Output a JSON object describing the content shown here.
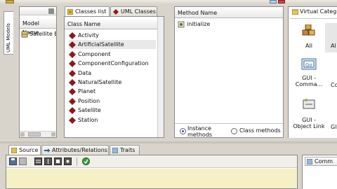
{
  "side_tab": {
    "label": "UML Models"
  },
  "models_panel": {
    "column_header": "Model Name",
    "items": [
      "Satellite E"
    ]
  },
  "classes_tabs": [
    {
      "label": "Classes list",
      "active": true
    },
    {
      "label": "UML Classes",
      "active": false
    }
  ],
  "classes_list": {
    "header": "Class Name",
    "items": [
      "Activity",
      "ArtificialSatellite",
      "Component",
      "ComponentConfiguration",
      "Data",
      "NaturalSatellite",
      "Planet",
      "Position",
      "Satellite",
      "Station"
    ],
    "selected_index": 1
  },
  "methods_panel": {
    "header": "Method Name",
    "items": [
      "initialize"
    ],
    "radio_instance": "Instance methods",
    "radio_class": "Class methods",
    "selected_radio": "instance"
  },
  "virtual_panel": {
    "tab_label": "Virtual Categ",
    "tiles": [
      "All",
      "GUI - Comma...",
      "GUI - Object Link"
    ],
    "partial_tiles": [
      "Al",
      "Co",
      "Gl"
    ]
  },
  "bottom_tabs": [
    {
      "label": "Source",
      "active": true
    },
    {
      "label": "Attributes/Relations",
      "active": false
    },
    {
      "label": "Traits",
      "active": false
    }
  ],
  "comm_panel": {
    "label": "Comm"
  },
  "colors": {
    "accent_red": "#8b1a1a",
    "editor_bg": "#f5f0c6",
    "chrome": "#d8d4cb"
  }
}
